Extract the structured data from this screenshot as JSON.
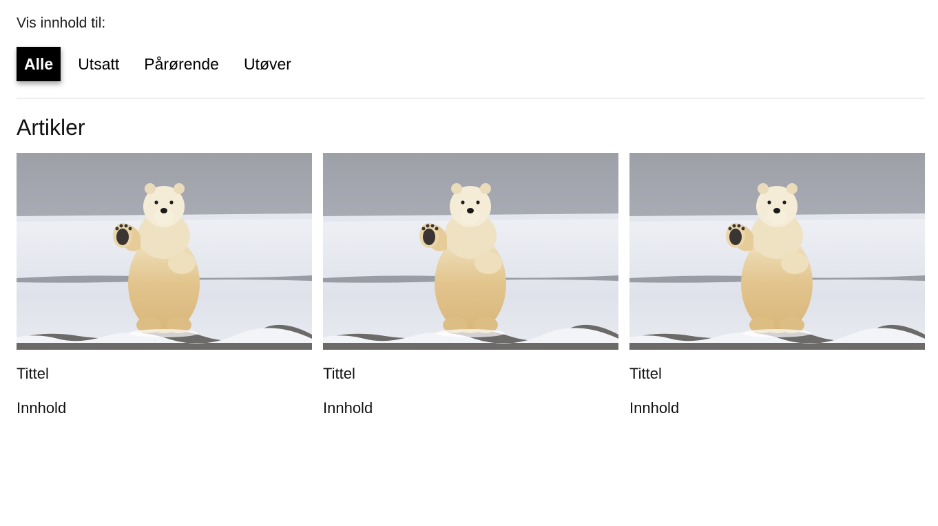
{
  "filter": {
    "label": "Vis innhold til:",
    "tabs": [
      {
        "label": "Alle",
        "active": true
      },
      {
        "label": "Utsatt",
        "active": false
      },
      {
        "label": "Pårørende",
        "active": false
      },
      {
        "label": "Utøver",
        "active": false
      }
    ]
  },
  "articles": {
    "heading": "Artikler",
    "cards": [
      {
        "image": "polar-bear-waving-photo",
        "title": "Tittel",
        "body": "Innhold"
      },
      {
        "image": "polar-bear-waving-photo",
        "title": "Tittel",
        "body": "Innhold"
      },
      {
        "image": "polar-bear-waving-photo",
        "title": "Tittel",
        "body": "Innhold"
      }
    ]
  },
  "colors": {
    "active_tab_bg": "#000000",
    "active_tab_text": "#ffffff",
    "divider": "#d6d6d6"
  }
}
